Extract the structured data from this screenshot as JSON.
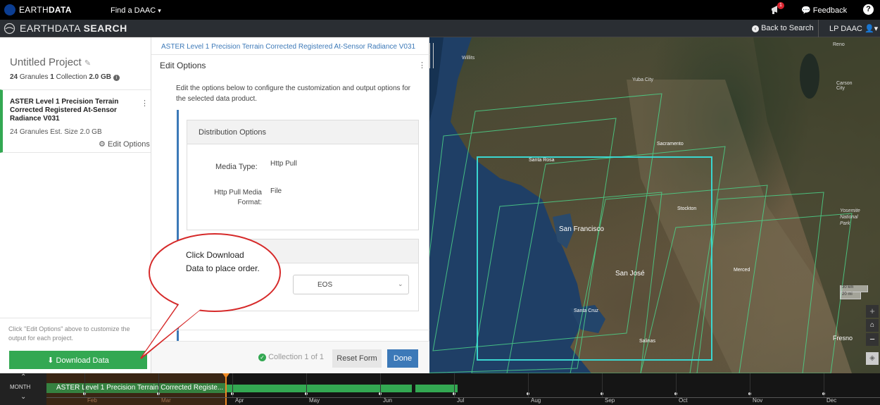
{
  "topbar": {
    "brand_plain": "EARTH",
    "brand_bold": "DATA",
    "daac_link": "Find a DAAC",
    "notification_count": "1",
    "feedback": "Feedback",
    "help": "?"
  },
  "searchbar": {
    "app_plain": "EARTHDATA ",
    "app_bold": "SEARCH",
    "back": "Back to Search",
    "user": "LP DAAC"
  },
  "project": {
    "title": "Untitled Project",
    "granules_count": "24",
    "granules_label": "Granules",
    "collections_count": "1",
    "collections_label": "Collection",
    "size": "2.0 GB",
    "collection_title": "ASTER Level 1 Precision Terrain Corrected Registered At-Sensor Radiance V031",
    "collection_stats": "24 Granules  Est. Size 2.0 GB",
    "edit_options": "Edit Options",
    "hint": "Click \"Edit Options\" above to customize the output for each project.",
    "download_button": "Download Data"
  },
  "edit_panel": {
    "breadcrumb": "ASTER Level 1 Precision Terrain Corrected Registered At-Sensor Radiance V031",
    "header": "Edit Options",
    "description": "Edit the options below to configure the customization and output options for the selected data product.",
    "distribution_title": "Distribution Options",
    "media_type_label": "Media Type:",
    "media_type_value": "Http Pull",
    "format_label_1": "Http Pull Media",
    "format_label_2": "Format:",
    "format_value": "File",
    "select_value": "EOS",
    "collection_status": "Collection 1 of 1",
    "reset_button": "Reset Form",
    "done_button": "Done"
  },
  "callout": {
    "text": "Click Download Data to place order."
  },
  "map": {
    "labels": {
      "willits": "Willits",
      "yuba": "Yuba City",
      "reno": "Reno",
      "carson": "Carson City",
      "santa_rosa": "Santa Rosa",
      "sacramento": "Sacramento",
      "stockton": "Stockton",
      "san_francisco": "San Francisco",
      "san_jose": "San José",
      "merced": "Merced",
      "yosemite": "Yosemite National Park",
      "santa_cruz": "Santa Cruz",
      "salinas": "Salinas",
      "fresno": "Fresno"
    },
    "scale_km": "30 km",
    "scale_mi": "20 mi"
  },
  "timeline": {
    "unit": "MONTH",
    "bar_label": "ASTER Level 1 Precision Terrain Corrected Registe...",
    "months": [
      "Feb",
      "Mar",
      "Apr",
      "May",
      "Jun",
      "Jul",
      "Aug",
      "Sep",
      "Oct",
      "Nov",
      "Dec"
    ]
  },
  "colors": {
    "accent_green": "#33a852",
    "accent_blue": "#3c79b8",
    "footprint_cyan": "#3ad6d0",
    "footprint_green": "#4cd48a"
  }
}
